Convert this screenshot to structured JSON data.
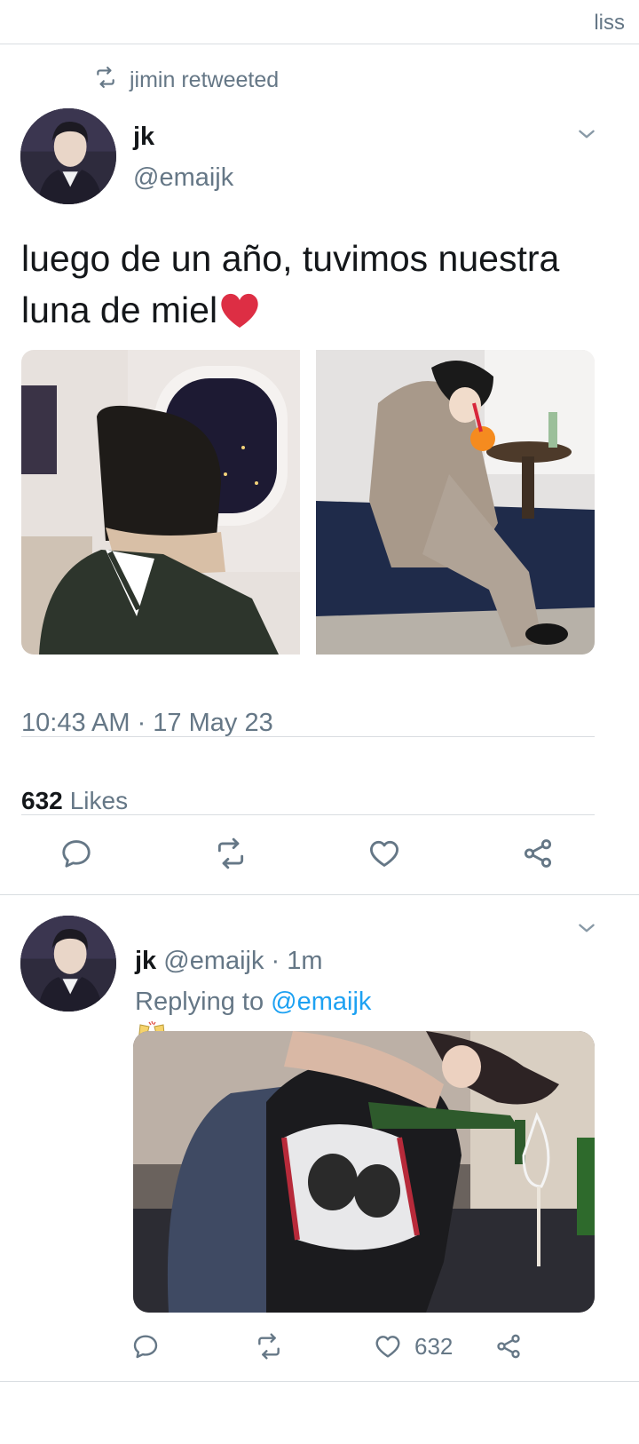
{
  "header": {
    "owner": "liss"
  },
  "main_tweet": {
    "retweeted_by": "jimin retweeted",
    "name": "jk",
    "handle": "@emaijk",
    "text": "luego de un año, tuvimos nuestra luna de miel",
    "text_emoji": "red-heart",
    "timestamp": "10:43 AM · 17 May 23",
    "likes_count": "632",
    "likes_label": "Likes",
    "photos": [
      "person in beanie looking out airplane window at night city",
      "person in plaid suit sipping from an orange on a bench"
    ]
  },
  "reply_tweet": {
    "name": "jk",
    "meta": "@emaijk · 1m",
    "replying_prefix": "Replying to",
    "replying_to": "@emaijk",
    "emoji": "clinking-glasses",
    "photo": "person pouring wine from a green bottle into a glass",
    "like_count": "632"
  },
  "icons": {
    "retweet": "retweet-icon",
    "chevron": "chevron-down-icon",
    "reply": "reply-icon",
    "like": "heart-icon",
    "share": "share-icon"
  },
  "colors": {
    "text": "#14171a",
    "secondary": "#657786",
    "link": "#1da1f2",
    "divider": "#d9dde1"
  }
}
